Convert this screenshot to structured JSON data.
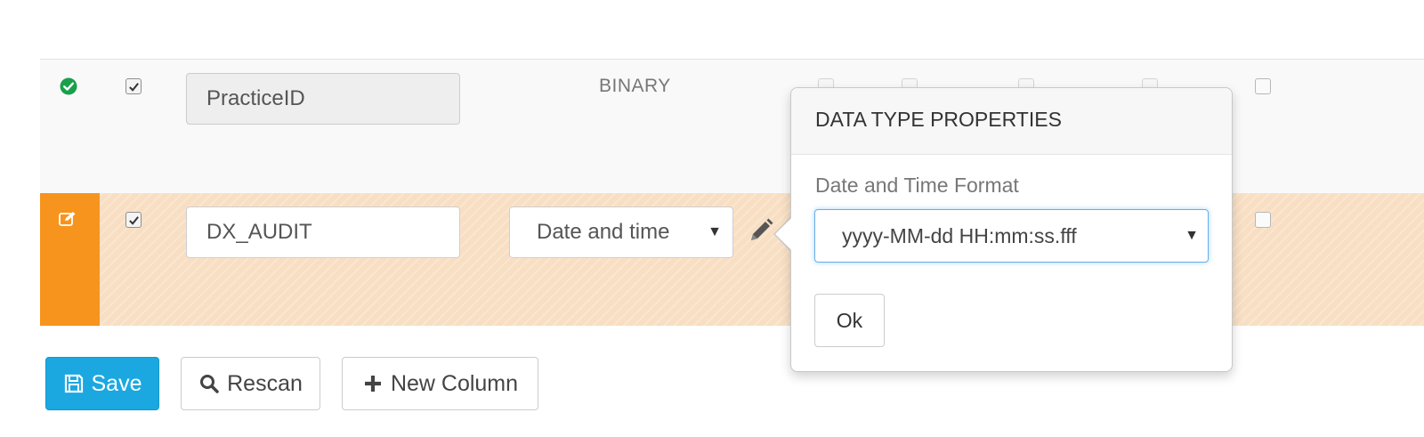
{
  "rows": [
    {
      "status": "ok",
      "selected": true,
      "column_name": "PracticeID",
      "data_type": "BINARY"
    },
    {
      "status": "editing",
      "selected": true,
      "column_name": "DX_AUDIT",
      "data_type": "Date and time"
    }
  ],
  "popover": {
    "title": "DATA TYPE PROPERTIES",
    "field_label": "Date and Time Format",
    "format_value": "yyyy-MM-dd HH:mm:ss.fff",
    "ok_label": "Ok"
  },
  "actions": {
    "save_label": "Save",
    "rescan_label": "Rescan",
    "new_column_label": "New Column"
  },
  "colors": {
    "editing_row": "#f8dfc3",
    "editing_status": "#f7941d",
    "primary": "#1ba8e0",
    "ok_status": "#1a9f4b",
    "focus_border": "#66afe9"
  },
  "icons": [
    "check-circle-icon",
    "edit-icon",
    "checkbox-icon",
    "pencil-icon",
    "chevron-down-icon",
    "save-icon",
    "search-icon",
    "plus-icon"
  ]
}
